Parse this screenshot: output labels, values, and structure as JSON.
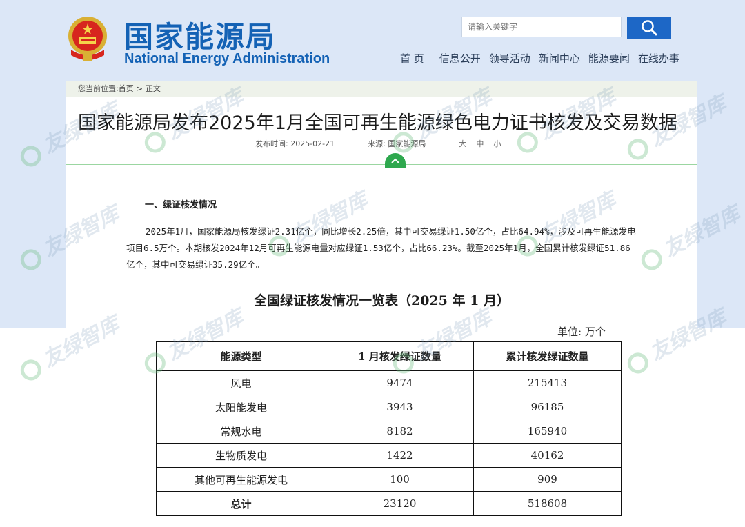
{
  "header": {
    "site_title": "国家能源局",
    "site_subtitle": "National Energy Administration",
    "search_placeholder": "请输入关键字",
    "nav": [
      "首 页",
      "信息公开",
      "领导活动",
      "新闻中心",
      "能源要闻",
      "在线办事"
    ]
  },
  "breadcrumb": {
    "prefix": "您当前位置:",
    "items": [
      "首页",
      "正文"
    ],
    "separator": ">"
  },
  "article": {
    "title": "国家能源局发布2025年1月全国可再生能源绿色电力证书核发及交易数据",
    "publish_time": "发布时间: 2025-02-21",
    "source": "来源: 国家能源局",
    "font_sizes": [
      "大",
      "中",
      "小"
    ],
    "section_heading": "一、绿证核发情况",
    "paragraph": "2025年1月，国家能源局核发绿证2.31亿个，同比增长2.25倍，其中可交易绿证1.50亿个，占比64.94%，涉及可再生能源发电项目6.5万个。本期核发2024年12月可再生能源电量对应绿证1.53亿个，占比66.23%。截至2025年1月，全国累计核发绿证51.86亿个，其中可交易绿证35.29亿个。"
  },
  "table": {
    "title": "全国绿证核发情况一览表（2025 年 1 月）",
    "unit": "单位: 万个",
    "headers": [
      "能源类型",
      "1 月核发绿证数量",
      "累计核发绿证数量"
    ],
    "rows": [
      [
        "风电",
        "9474",
        "215413"
      ],
      [
        "太阳能发电",
        "3943",
        "96185"
      ],
      [
        "常规水电",
        "8182",
        "165940"
      ],
      [
        "生物质发电",
        "1422",
        "40162"
      ],
      [
        "其他可再生能源发电",
        "100",
        "909"
      ],
      [
        "总计",
        "23120",
        "518608"
      ]
    ]
  },
  "watermark": "友绿智库",
  "colors": {
    "brand_blue": "#1462b5",
    "search_button": "#1d67c6",
    "accent_green": "#2ea84e"
  }
}
